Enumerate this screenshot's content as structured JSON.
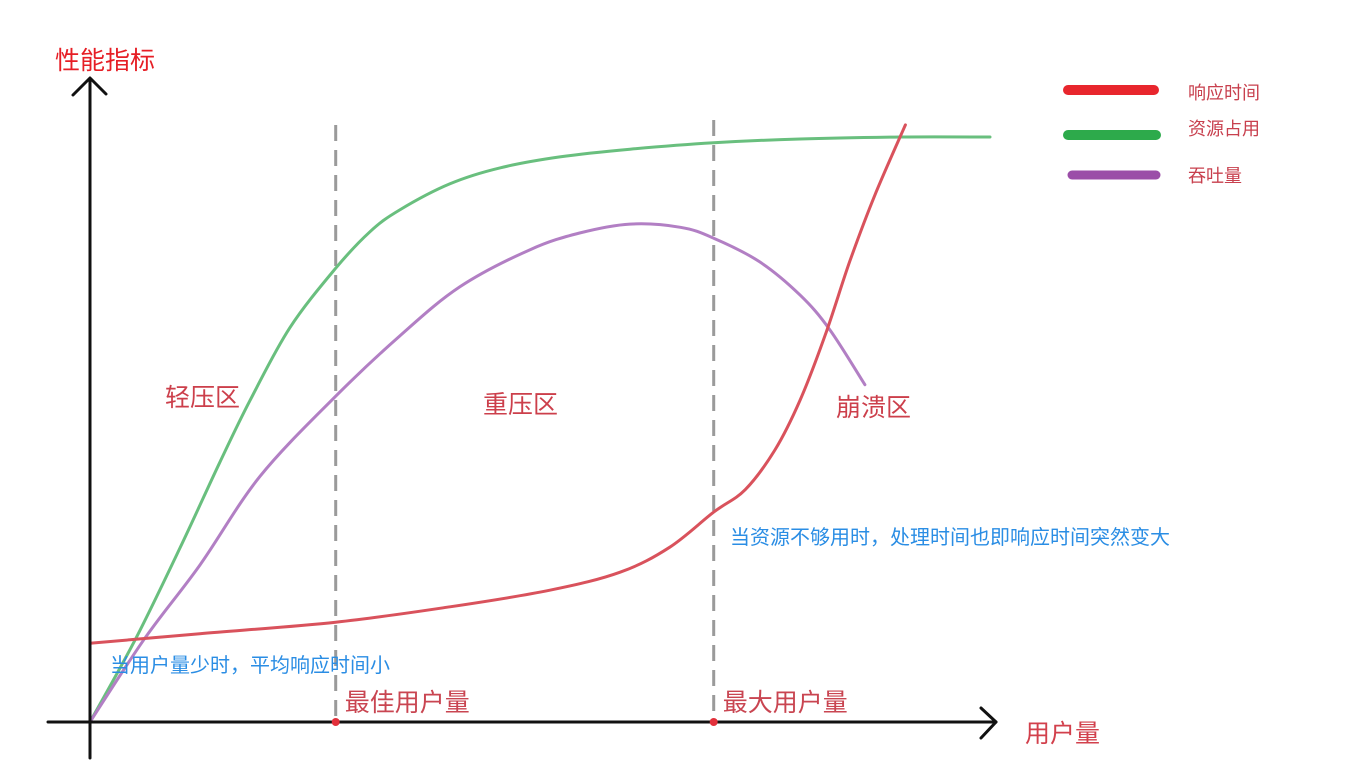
{
  "chart_data": {
    "type": "line",
    "ylabel": "性能指标",
    "xlabel": "用户量",
    "xlim": [
      0,
      100
    ],
    "ylim": [
      0,
      100
    ],
    "grid": false,
    "legend": "top-right",
    "series": [
      {
        "name": "响应时间",
        "color": "#d9525c",
        "legend_color": "#e8262d",
        "points": [
          [
            0,
            12.3
          ],
          [
            12.2,
            13.8
          ],
          [
            27.3,
            15.6
          ],
          [
            40,
            18
          ],
          [
            51.1,
            20.6
          ],
          [
            58.9,
            23.4
          ],
          [
            64.4,
            27.3
          ],
          [
            69.3,
            32.8
          ],
          [
            72.8,
            36.3
          ],
          [
            76.1,
            42.5
          ],
          [
            78.9,
            50.3
          ],
          [
            81.7,
            60.5
          ],
          [
            84.4,
            71.9
          ],
          [
            87.2,
            82.3
          ],
          [
            90.6,
            93.3
          ]
        ]
      },
      {
        "name": "资源占用",
        "color": "#69bf7e",
        "legend_color": "#2daa4b",
        "points": [
          [
            0,
            0
          ],
          [
            5,
            12.8
          ],
          [
            10,
            27.2
          ],
          [
            14.4,
            40.5
          ],
          [
            17.8,
            50.3
          ],
          [
            22.2,
            61.6
          ],
          [
            27.3,
            70.9
          ],
          [
            31.1,
            76.6
          ],
          [
            34.4,
            80
          ],
          [
            40,
            84.1
          ],
          [
            45.6,
            86.6
          ],
          [
            52.2,
            88.3
          ],
          [
            60,
            89.5
          ],
          [
            69.3,
            90.5
          ],
          [
            78.9,
            91.1
          ],
          [
            90,
            91.4
          ],
          [
            100,
            91.4
          ]
        ]
      },
      {
        "name": "吞吐量",
        "color": "#b27fc4",
        "legend_color": "#9b4ea8",
        "points": [
          [
            0,
            0
          ],
          [
            6.1,
            13.1
          ],
          [
            12.2,
            24.5
          ],
          [
            18.9,
            38.4
          ],
          [
            27.3,
            50.9
          ],
          [
            34.4,
            60.3
          ],
          [
            41.1,
            68
          ],
          [
            48.9,
            73.8
          ],
          [
            54.4,
            76.4
          ],
          [
            60,
            77.8
          ],
          [
            65.6,
            77.3
          ],
          [
            69.3,
            75.6
          ],
          [
            74.4,
            71.9
          ],
          [
            78.9,
            66.7
          ],
          [
            82.2,
            61.3
          ],
          [
            86.1,
            52.7
          ]
        ]
      }
    ],
    "markers": [
      {
        "label": "最佳用户量",
        "x": 27.3
      },
      {
        "label": "最大用户量",
        "x": 69.3
      }
    ],
    "regions": [
      {
        "label": "轻压区"
      },
      {
        "label": "重压区"
      },
      {
        "label": "崩溃区"
      }
    ],
    "annotations": [
      {
        "text": "当用户量少时，平均响应时间小"
      },
      {
        "text": "当资源不够用时，处理时间也即响应时间突然变大"
      }
    ]
  }
}
